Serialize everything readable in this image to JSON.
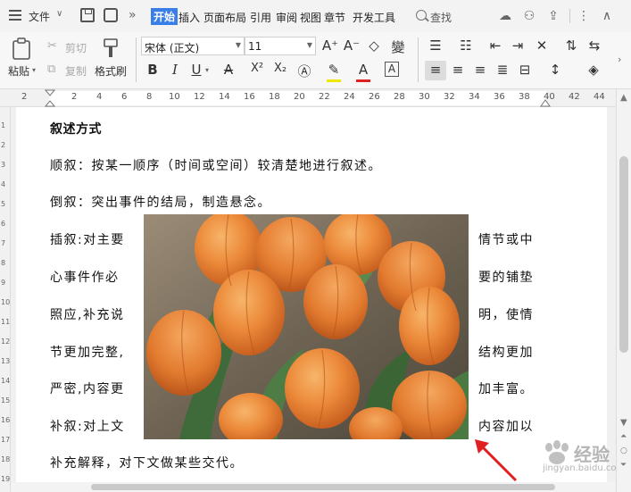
{
  "menubar": {
    "file_label": "文件",
    "tabs": [
      "开始",
      "插入",
      "页面布局",
      "引用",
      "审阅",
      "视图",
      "章节",
      "开发工具"
    ],
    "search_label": "查找"
  },
  "ribbon": {
    "paste_label": "粘贴",
    "cut_label": "剪切",
    "copy_label": "复制",
    "format_painter_label": "格式刷",
    "font_name": "宋体 (正文)",
    "font_size": "11",
    "bold": "B",
    "italic": "I",
    "underline": "U",
    "superscript": "X²",
    "subscript": "X₂"
  },
  "ruler": {
    "ticks": [
      "2",
      "2",
      "4",
      "6",
      "8",
      "10",
      "12",
      "14",
      "16",
      "18",
      "20",
      "22",
      "24",
      "26",
      "28",
      "30",
      "32",
      "34",
      "36",
      "38",
      "40",
      "42",
      "44"
    ]
  },
  "vruler": {
    "ticks": [
      "1",
      "2",
      "3",
      "4",
      "5",
      "6",
      "7",
      "8",
      "9",
      "10",
      "11",
      "12",
      "13",
      "14",
      "15",
      "16",
      "17",
      "18",
      "19"
    ]
  },
  "document": {
    "title": "叙述方式",
    "lines": [
      "顺叙：按某一顺序（时间或空间）较清楚地进行叙述。",
      "倒叙：突出事件的结局，制造悬念。"
    ],
    "left_col": [
      "插叙:对主要",
      "心事件作必",
      "照应,补充说",
      "节更加完整,",
      "严密,内容更",
      "补叙:对上文"
    ],
    "right_col": [
      "情节或中",
      "要的铺垫",
      "明，使情",
      "结构更加",
      "加丰富。",
      "内容加以"
    ],
    "last_line": "补充解释，对下文做某些交代。"
  },
  "watermark": {
    "text": "经验",
    "sub": "jingyan.baidu.com"
  },
  "colors": {
    "accent": "#3a7ee8",
    "annotation_arrow": "#e02020"
  }
}
